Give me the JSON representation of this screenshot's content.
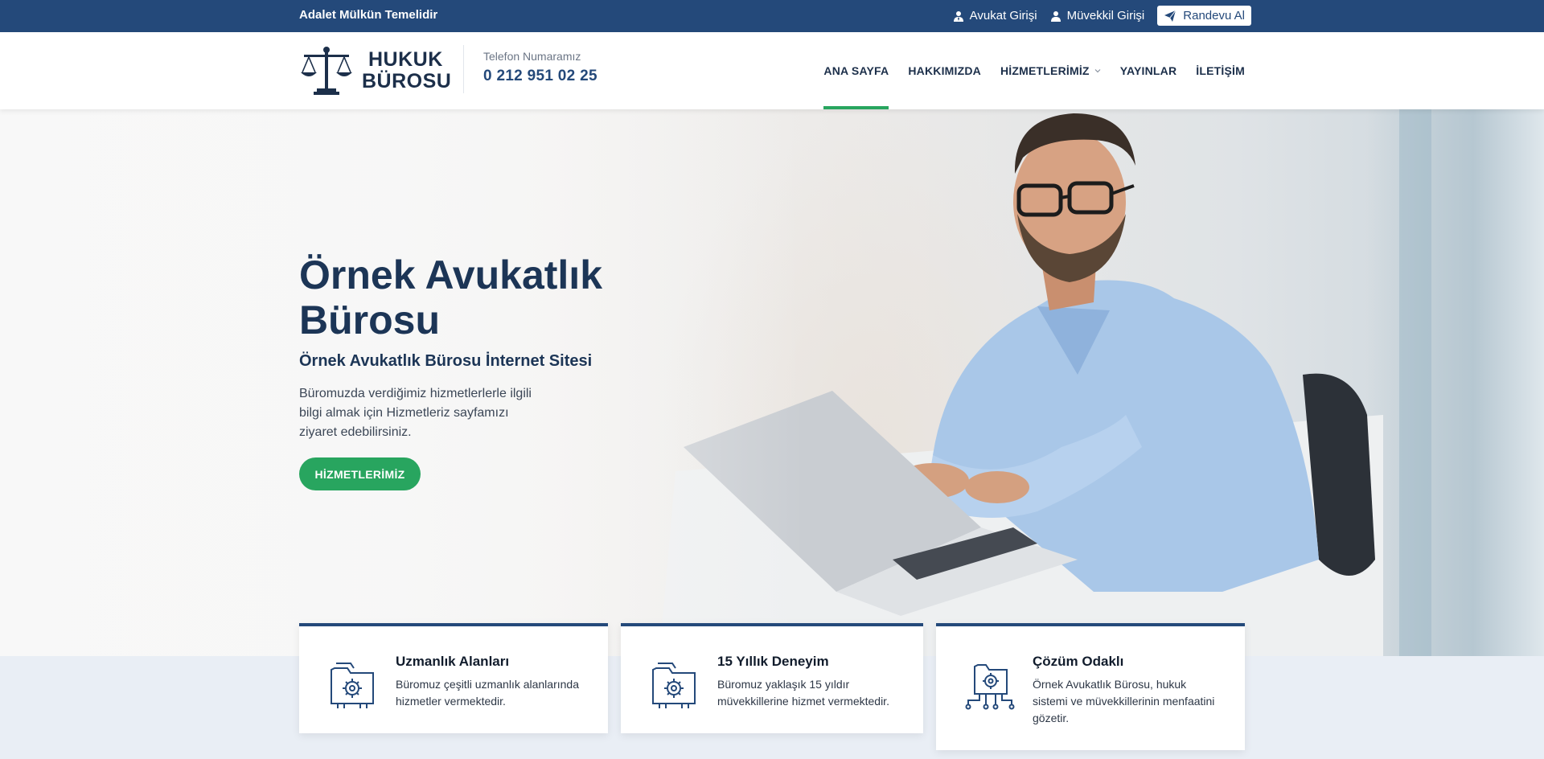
{
  "topbar": {
    "motto": "Adalet Mülkün Temelidir",
    "lawyer_login": "Avukat Girişi",
    "client_login": "Müvekkil Girişi",
    "appointment": "Randevu Al"
  },
  "header": {
    "logo_line1": "HUKUK",
    "logo_line2": "BÜROSU",
    "phone_label": "Telefon Numaramız",
    "phone_number": "0 212 951 02 25"
  },
  "nav": {
    "items": [
      "ANA SAYFA",
      "HAKKIMIZDA",
      "HİZMETLERİMİZ",
      "YAYINLAR",
      "İLETİŞİM"
    ],
    "active": "ANA SAYFA"
  },
  "hero": {
    "title": "Örnek Avukatlık Bürosu",
    "subtitle": "Örnek Avukatlık Bürosu İnternet Sitesi",
    "text": "Büromuzda verdiğimiz hizmetlerlerle ilgili bilgi almak için Hizmetleriz sayfamızı ziyaret edebilirsiniz.",
    "button": "HİZMETLERİMİZ"
  },
  "features": [
    {
      "title": "Uzmanlık Alanları",
      "text": "Büromuz çeşitli uzmanlık alanlarında hizmetler vermektedir.",
      "icon": "folder-gear-icon"
    },
    {
      "title": "15 Yıllık Deneyim",
      "text": "Büromuz yaklaşık 15 yıldır müvekkillerine hizmet vermektedir.",
      "icon": "folder-gear-icon"
    },
    {
      "title": "Çözüm Odaklı",
      "text": "Örnek Avukatlık Bürosu, hukuk sistemi ve müvekkillerinin menfaatini gözetir.",
      "icon": "network-gear-icon"
    }
  ],
  "colors": {
    "primary": "#24497a",
    "accent": "#28a55f",
    "dark_text": "#1c3556"
  }
}
